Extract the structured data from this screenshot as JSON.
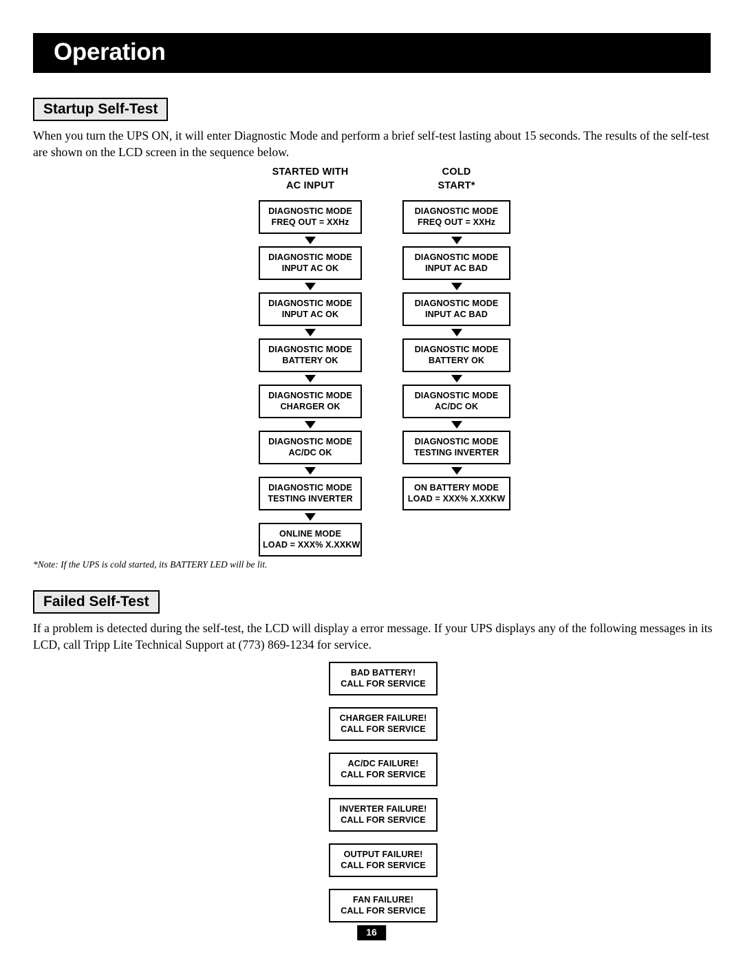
{
  "page": {
    "header_title": "Operation",
    "page_number": "16",
    "colors": {
      "header_bar": "#000000",
      "header_text": "#ffffff",
      "chip_fill": "#e9e9e9",
      "border": "#000000",
      "body_text": "#000000"
    }
  },
  "startup_section": {
    "heading": "Startup Self-Test",
    "paragraph": "When you turn the UPS ON, it will enter Diagnostic Mode and perform a brief self-test lasting about 15 seconds. The results of the self-test are shown on the LCD screen in the sequence below.",
    "note": "*Note: If the UPS is cold started, its BATTERY LED will be lit."
  },
  "flowchart": {
    "columns": [
      {
        "heading_line1": "STARTED WITH",
        "heading_line2": "AC INPUT",
        "steps": [
          {
            "line1": "DIAGNOSTIC MODE",
            "line2": "FREQ OUT = XXHz"
          },
          {
            "line1": "DIAGNOSTIC MODE",
            "line2": "INPUT AC OK"
          },
          {
            "line1": "DIAGNOSTIC MODE",
            "line2": "INPUT AC OK"
          },
          {
            "line1": "DIAGNOSTIC MODE",
            "line2": "BATTERY OK"
          },
          {
            "line1": "DIAGNOSTIC MODE",
            "line2": "CHARGER OK"
          },
          {
            "line1": "DIAGNOSTIC MODE",
            "line2": "AC/DC OK"
          },
          {
            "line1": "DIAGNOSTIC MODE",
            "line2": "TESTING INVERTER"
          },
          {
            "line1": "ONLINE MODE",
            "line2": "LOAD = XXX% X.XXKW"
          }
        ]
      },
      {
        "heading_line1": "COLD",
        "heading_line2": "START*",
        "steps": [
          {
            "line1": "DIAGNOSTIC MODE",
            "line2": "FREQ OUT = XXHz"
          },
          {
            "line1": "DIAGNOSTIC MODE",
            "line2": "INPUT AC BAD"
          },
          {
            "line1": "DIAGNOSTIC MODE",
            "line2": "INPUT AC BAD"
          },
          {
            "line1": "DIAGNOSTIC MODE",
            "line2": "BATTERY OK"
          },
          {
            "line1": "DIAGNOSTIC MODE",
            "line2": "AC/DC OK"
          },
          {
            "line1": "DIAGNOSTIC MODE",
            "line2": "TESTING INVERTER"
          },
          {
            "line1": "ON BATTERY MODE",
            "line2": "LOAD = XXX% X.XXKW"
          }
        ]
      }
    ]
  },
  "failed_section": {
    "heading": "Failed Self-Test",
    "paragraph": "If a problem is detected during the self-test, the LCD will display a error message. If your UPS displays any of the following messages in its LCD, call Tripp Lite Technical Support at (773) 869-1234 for service.",
    "messages": [
      {
        "line1": "BAD BATTERY!",
        "line2": "CALL FOR SERVICE"
      },
      {
        "line1": "CHARGER FAILURE!",
        "line2": "CALL FOR SERVICE"
      },
      {
        "line1": "AC/DC FAILURE!",
        "line2": "CALL FOR SERVICE"
      },
      {
        "line1": "INVERTER FAILURE!",
        "line2": "CALL FOR SERVICE"
      },
      {
        "line1": "OUTPUT FAILURE!",
        "line2": "CALL FOR SERVICE"
      },
      {
        "line1": "FAN FAILURE!",
        "line2": "CALL FOR SERVICE"
      }
    ]
  }
}
